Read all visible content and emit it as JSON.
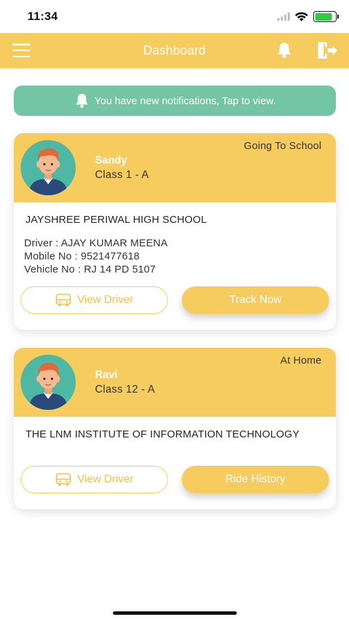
{
  "status_bar": {
    "time": "11:34",
    "icons": [
      "signal-icon",
      "wifi-icon",
      "battery-charging-icon"
    ],
    "battery_level": 0.85
  },
  "header": {
    "title": "Dashboard",
    "icons": [
      "menu-icon",
      "bell-icon",
      "logout-icon"
    ]
  },
  "notification": {
    "text": "You have new notifications, Tap to view.",
    "icon": "bell-icon"
  },
  "students": [
    {
      "name": "Sandy",
      "class": "Class 1 - A",
      "status": "Going To School",
      "school": "JAYSHREE PERIWAL HIGH SCHOOL",
      "driver": "Driver : AJAY KUMAR MEENA",
      "mobile": "Mobile No : 9521477618",
      "vehicle": "Vehicle No : RJ 14 PD 5107",
      "view_driver_label": "View Driver",
      "action_label": "Track Now"
    },
    {
      "name": "Ravi",
      "class": "Class 12 - A",
      "status": "At Home",
      "school": "THE LNM INSTITUTE OF INFORMATION TECHNOLOGY",
      "view_driver_label": "View Driver",
      "action_label": "Ride History"
    }
  ],
  "colors": {
    "accent": "#f6cc5f",
    "banner": "#74c5a5",
    "avatar_bg": "#4fb8a4"
  }
}
